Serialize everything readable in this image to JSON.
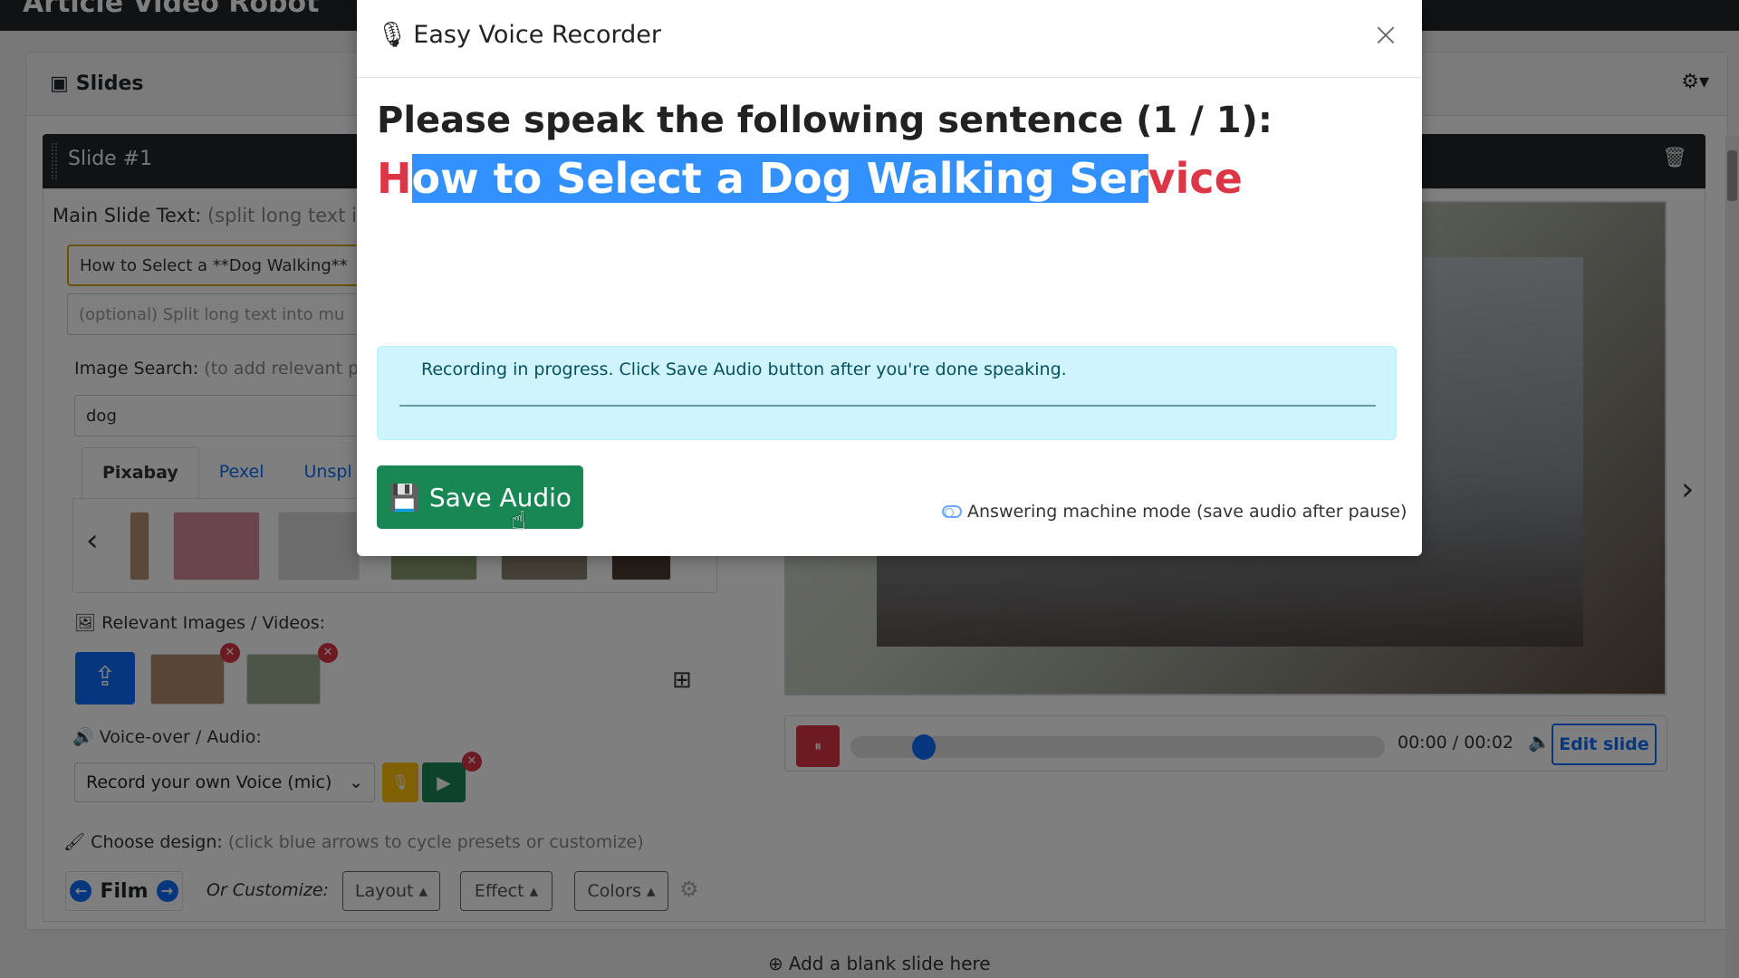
{
  "app": {
    "title": "Article Video Robot"
  },
  "slides_panel": {
    "title": "Slides",
    "slide": {
      "label": "Slide #1",
      "main_text_label": "Main Slide Text:",
      "main_text_hint": "(split long text in",
      "main_text_value": "How to Select a **Dog Walking**",
      "split_placeholder": "(optional) Split long text into mu",
      "image_search_label": "Image Search:",
      "image_search_hint": "(to add relevant ph",
      "image_search_value": "dog",
      "source_tabs": [
        {
          "label": "Pixabay",
          "active": true
        },
        {
          "label": "Pexel",
          "active": false
        },
        {
          "label": "Unspl",
          "active": false
        }
      ],
      "relevant_label": "Relevant Images / Videos:",
      "voice_label": "Voice-over / Audio:",
      "voice_select": "Record your own Voice (mic)",
      "design_label": "Choose design:",
      "design_hint": "(click blue arrows to cycle presets or customize)",
      "design_preset": "Film",
      "customize_label": "Or Customize:",
      "customize_buttons": [
        "Layout",
        "Effect",
        "Colors"
      ],
      "player": {
        "time": "00:00 / 00:02",
        "progress_fraction": 0.12
      },
      "edit_slide": "Edit slide"
    },
    "add_slide": "Add a blank slide here"
  },
  "modal": {
    "title": "Easy Voice Recorder",
    "prompt": "Please speak the following sentence (1 / 1):",
    "sentence_first": "H",
    "sentence_selected": "ow to Select a Dog Walking Ser",
    "sentence_rest": "vice",
    "alert": "Recording in progress. Click Save Audio button after you're done speaking.",
    "save_button": "Save Audio",
    "answering_mode": "Answering machine mode (save audio after pause)"
  },
  "colors": {
    "primary": "#0d6efd",
    "success": "#198754",
    "danger": "#dc3545",
    "warning": "#ffc107",
    "info_bg": "#cff4fc"
  }
}
